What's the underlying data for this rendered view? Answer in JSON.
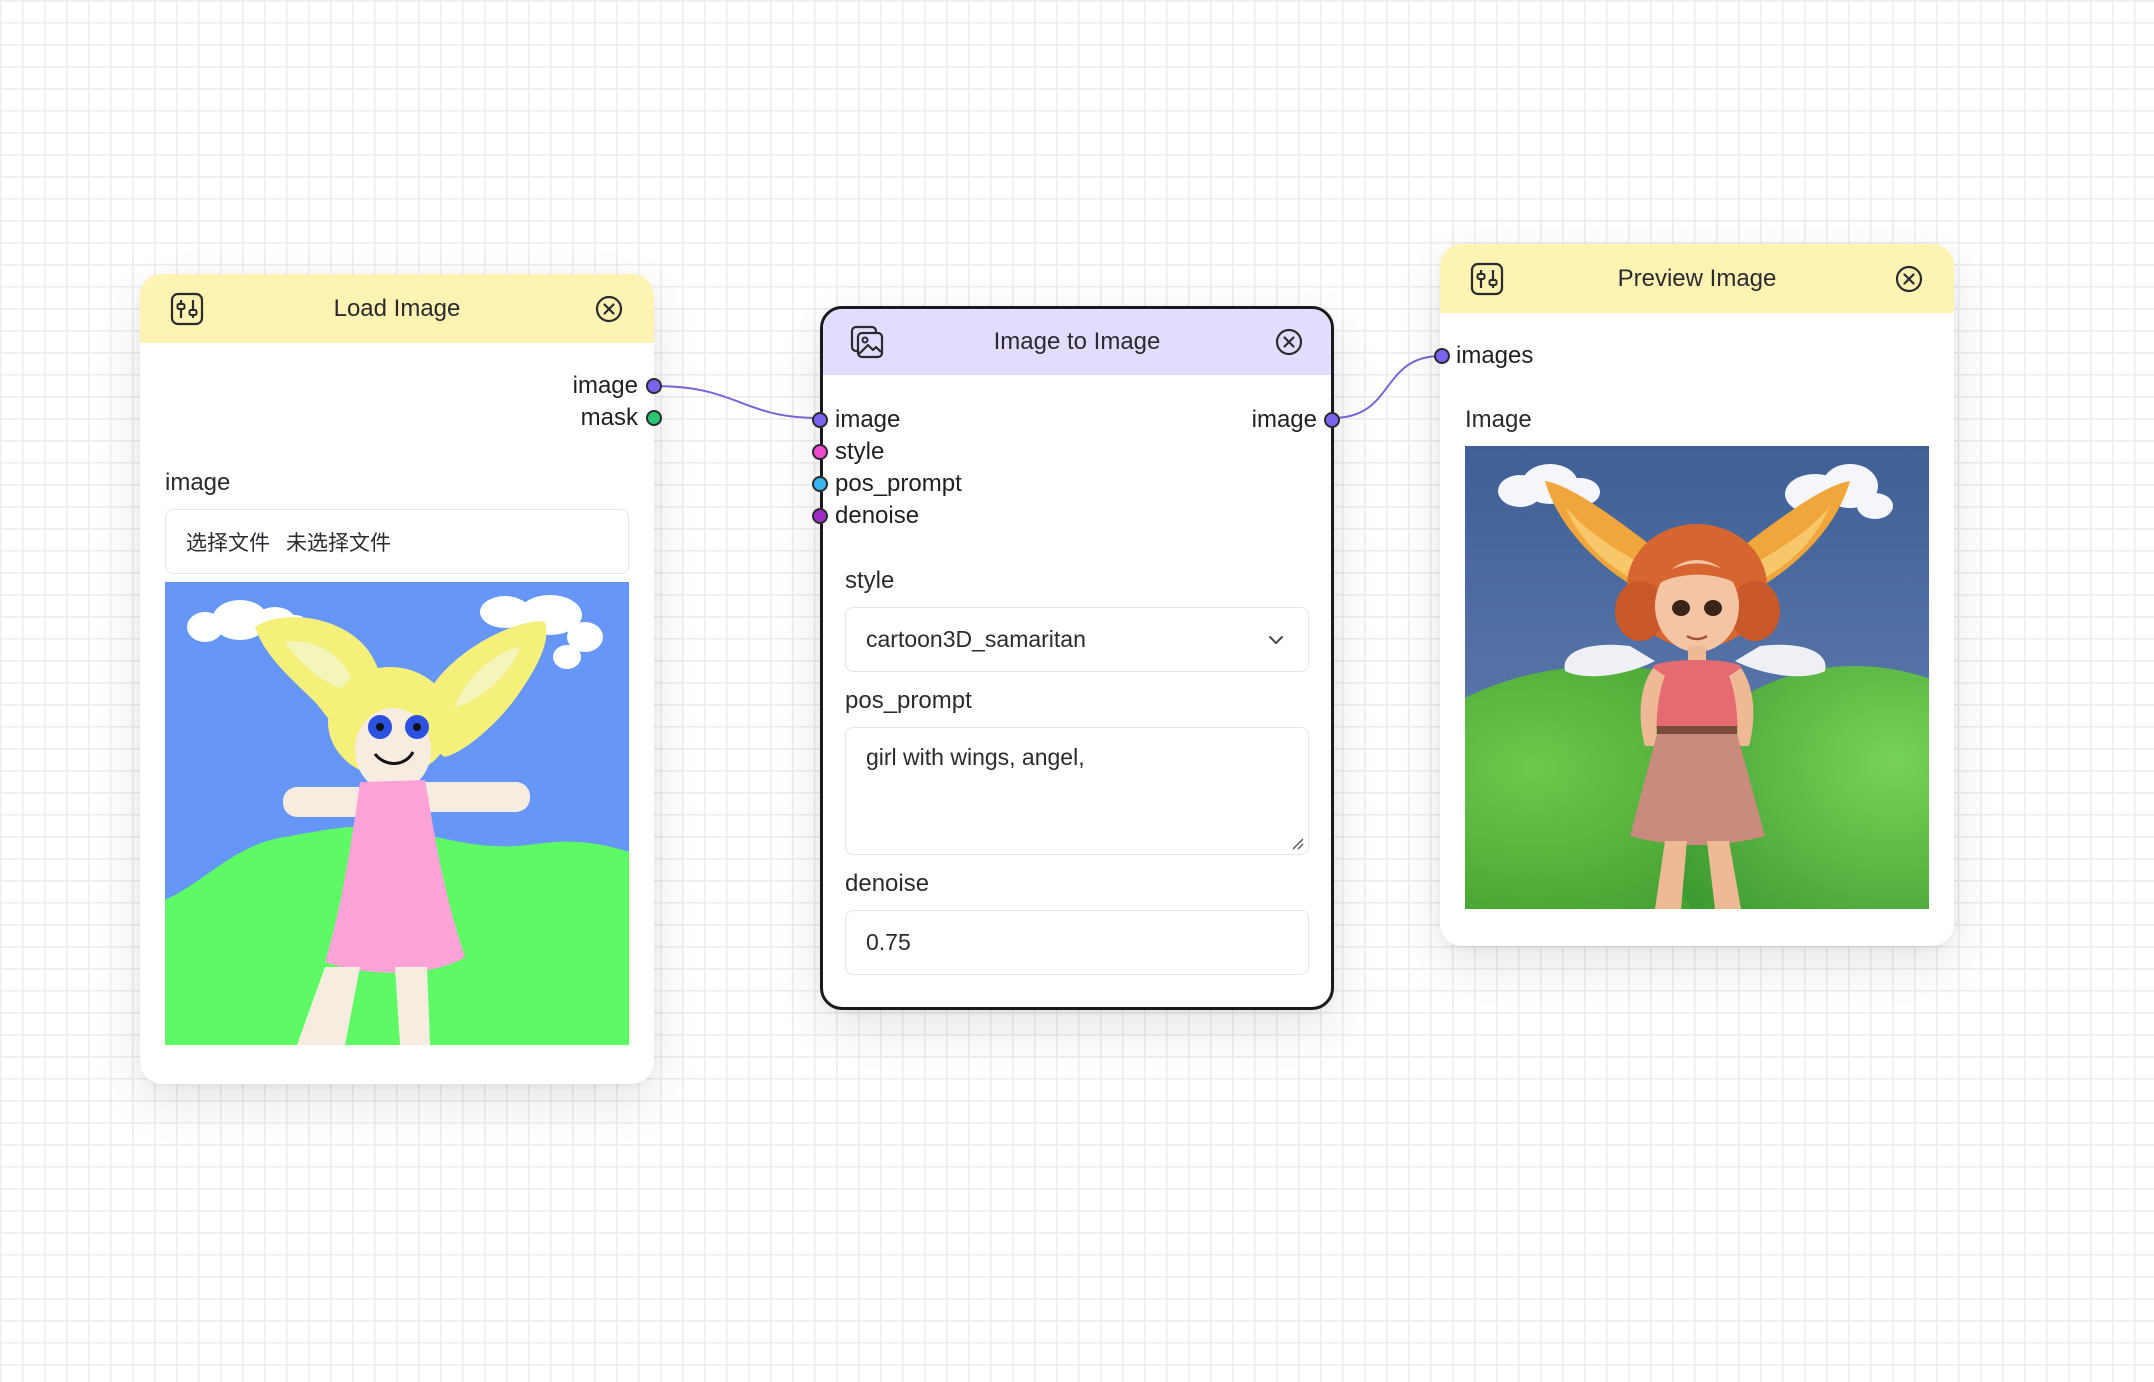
{
  "colors": {
    "header_yellow": "#fdf3b2",
    "header_purple": "#e4dcfd",
    "port_image": "#7b63f0",
    "port_mask": "#28c76f",
    "port_style": "#f04bd0",
    "port_pos_prompt": "#39b6f0",
    "port_denoise": "#9b2fc4",
    "wire": "#7b63d8"
  },
  "nodes": {
    "load_image": {
      "title": "Load Image",
      "header_icon": "sliders-icon",
      "outputs": [
        {
          "label": "image",
          "type": "image"
        },
        {
          "label": "mask",
          "type": "mask"
        }
      ],
      "image_field": {
        "label": "image",
        "file_button": "选择文件",
        "file_status": "未选择文件"
      }
    },
    "image_to_image": {
      "title": "Image to Image",
      "header_icon": "images-icon",
      "inputs": [
        {
          "label": "image",
          "type": "image"
        },
        {
          "label": "style",
          "type": "style"
        },
        {
          "label": "pos_prompt",
          "type": "pos_prompt"
        },
        {
          "label": "denoise",
          "type": "denoise"
        }
      ],
      "outputs": [
        {
          "label": "image",
          "type": "image"
        }
      ],
      "style_field": {
        "label": "style",
        "value": "cartoon3D_samaritan"
      },
      "pos_prompt_field": {
        "label": "pos_prompt",
        "value": "girl with wings, angel,"
      },
      "denoise_field": {
        "label": "denoise",
        "value": "0.75"
      }
    },
    "preview_image": {
      "title": "Preview Image",
      "header_icon": "sliders-icon",
      "inputs": [
        {
          "label": "images",
          "type": "image"
        }
      ],
      "image_label": "Image"
    }
  }
}
